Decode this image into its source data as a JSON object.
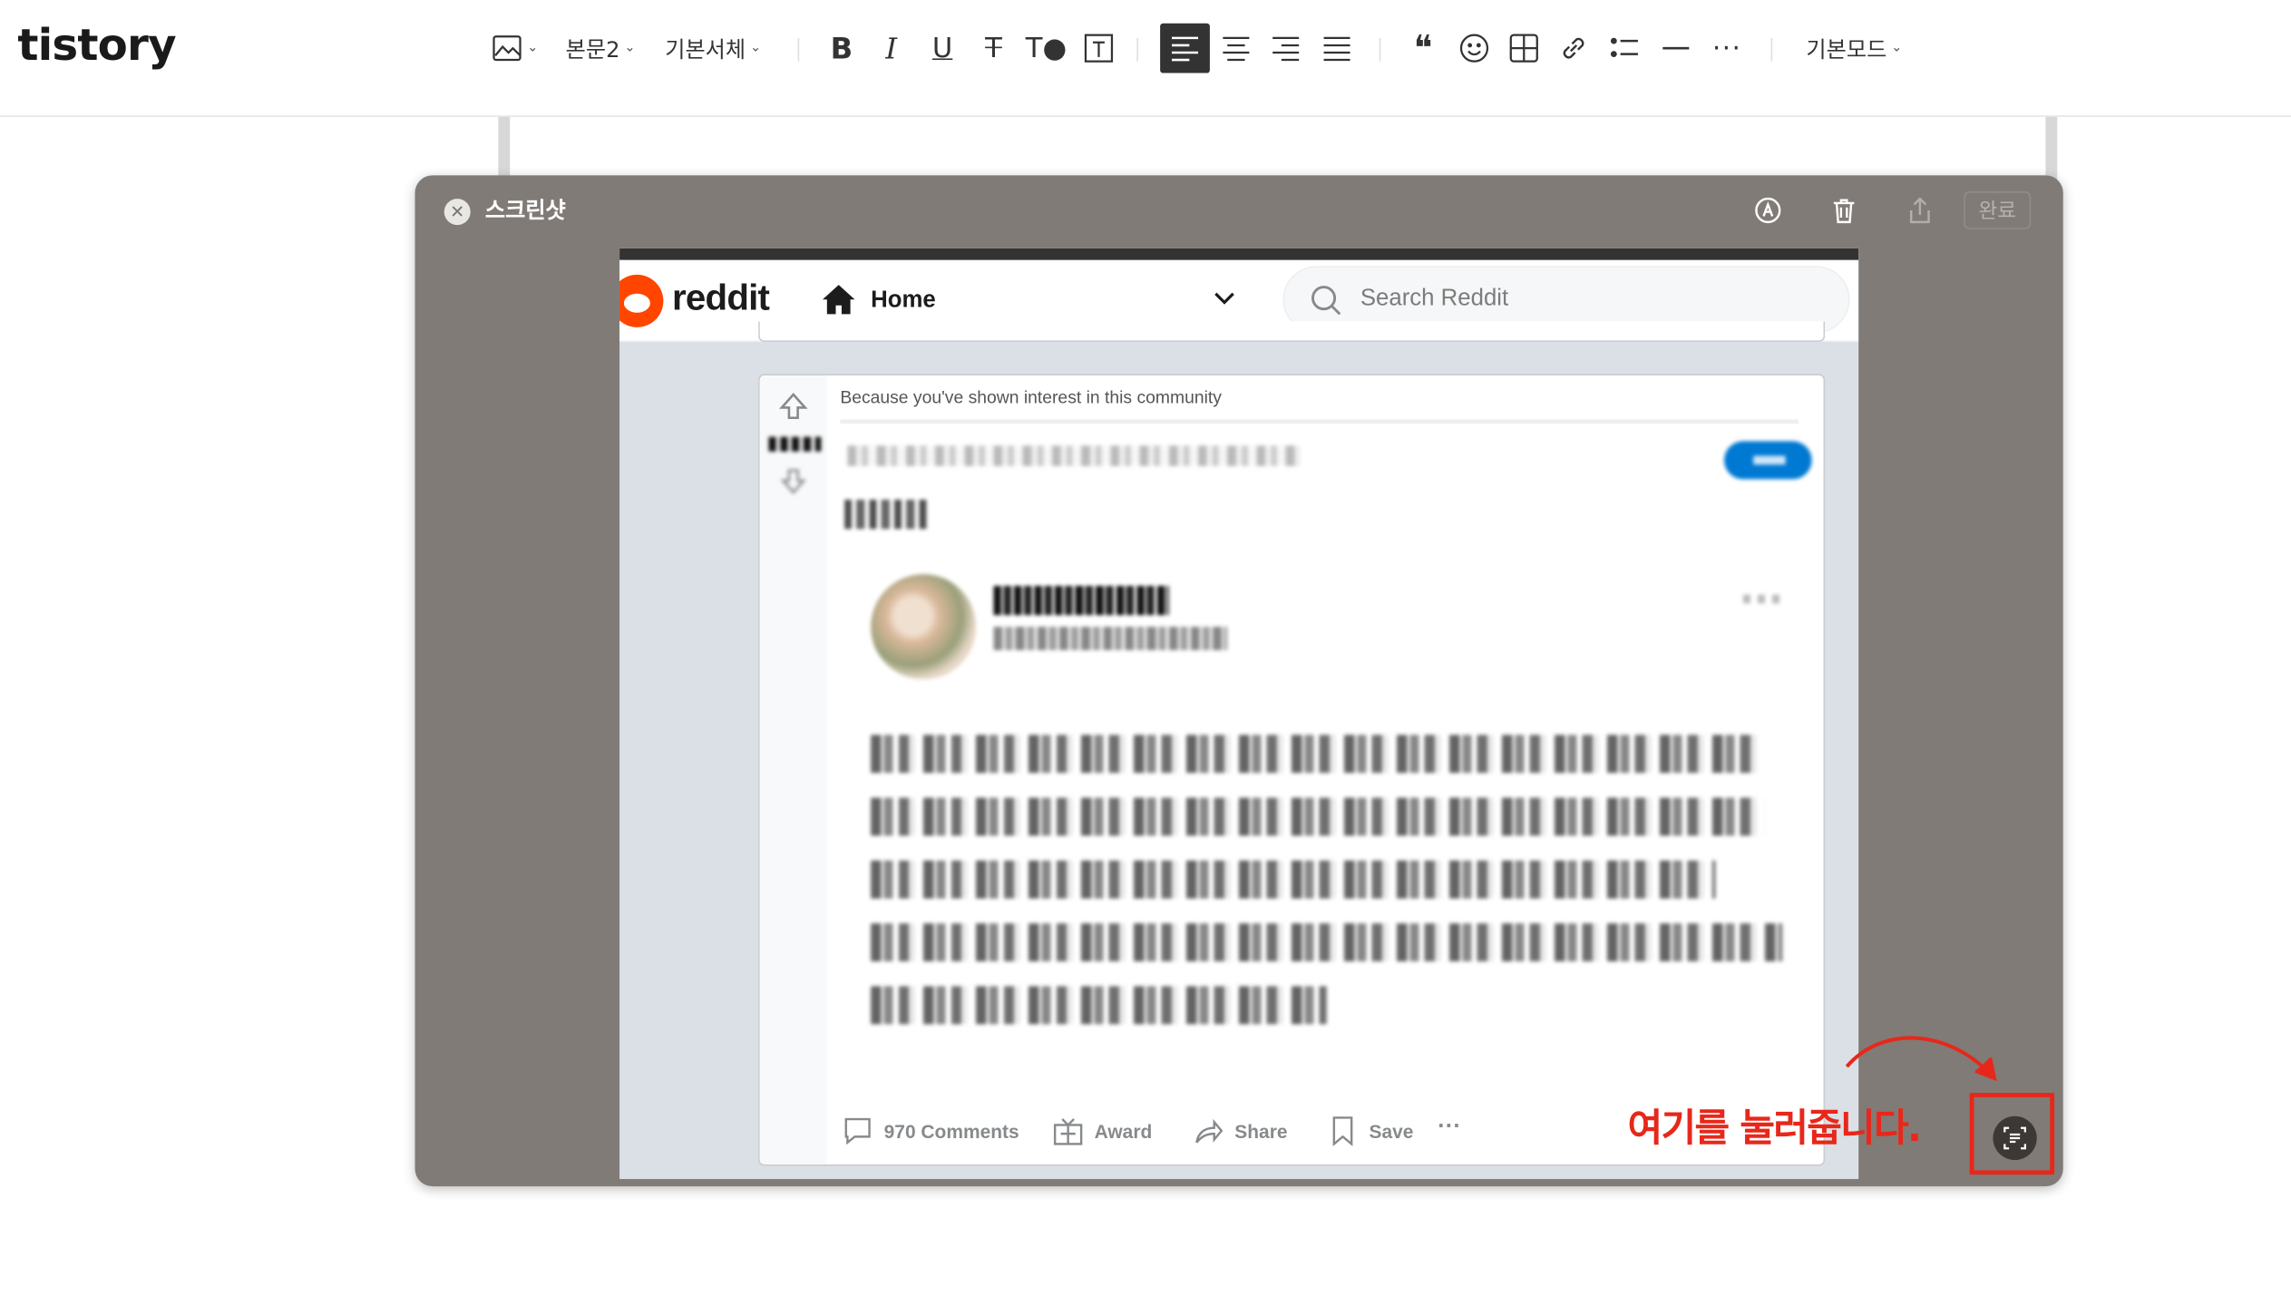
{
  "app": {
    "logo": "tistory"
  },
  "toolbar": {
    "paragraph_style": "본문2",
    "font": "기본서체",
    "mode": "기본모드",
    "icons": [
      "image-icon",
      "bold-icon",
      "italic-icon",
      "underline-icon",
      "strikethrough-icon",
      "text-color-icon",
      "text-background-icon",
      "align-left-icon",
      "align-center-icon",
      "align-right-icon",
      "align-justify-icon",
      "quote-icon",
      "emoji-icon",
      "table-icon",
      "link-icon",
      "list-icon",
      "divider-icon",
      "more-icon"
    ],
    "active_align": "left"
  },
  "modal": {
    "title": "스크린샷",
    "done_label": "완료"
  },
  "reddit": {
    "wordmark": "reddit",
    "nav_home": "Home",
    "search_placeholder": "Search Reddit",
    "reason": "Because you've shown interest in this community",
    "actions": {
      "comments": "970 Comments",
      "award": "Award",
      "share": "Share",
      "save": "Save"
    }
  },
  "annotation": {
    "text": "여기를 눌러줍니다."
  },
  "colors": {
    "modal_bg": "#807b76",
    "reddit_orange": "#ff4500",
    "reddit_blue": "#0079d3",
    "annotation_red": "#e8271b"
  }
}
